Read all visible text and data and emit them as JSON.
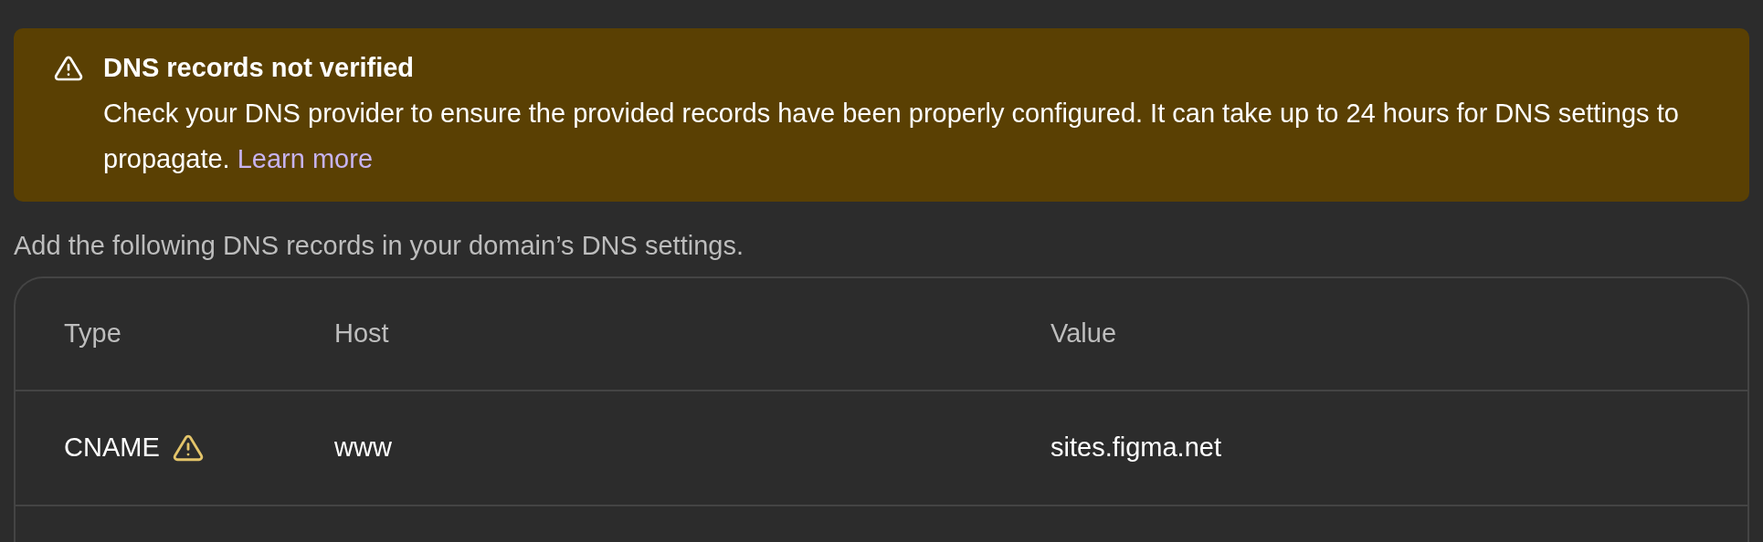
{
  "banner": {
    "title": "DNS records not verified",
    "message": "Check your DNS provider to ensure the provided records have been properly configured. It can take up to 24 hours for DNS settings to propagate.",
    "link": "Learn more"
  },
  "instructions": "Add the following DNS records in your domain’s DNS settings.",
  "table": {
    "columns": [
      "Type",
      "Host",
      "Value"
    ],
    "rows": [
      {
        "type": "CNAME",
        "warning": true,
        "host": "www",
        "value": "sites.figma.net"
      }
    ]
  }
}
